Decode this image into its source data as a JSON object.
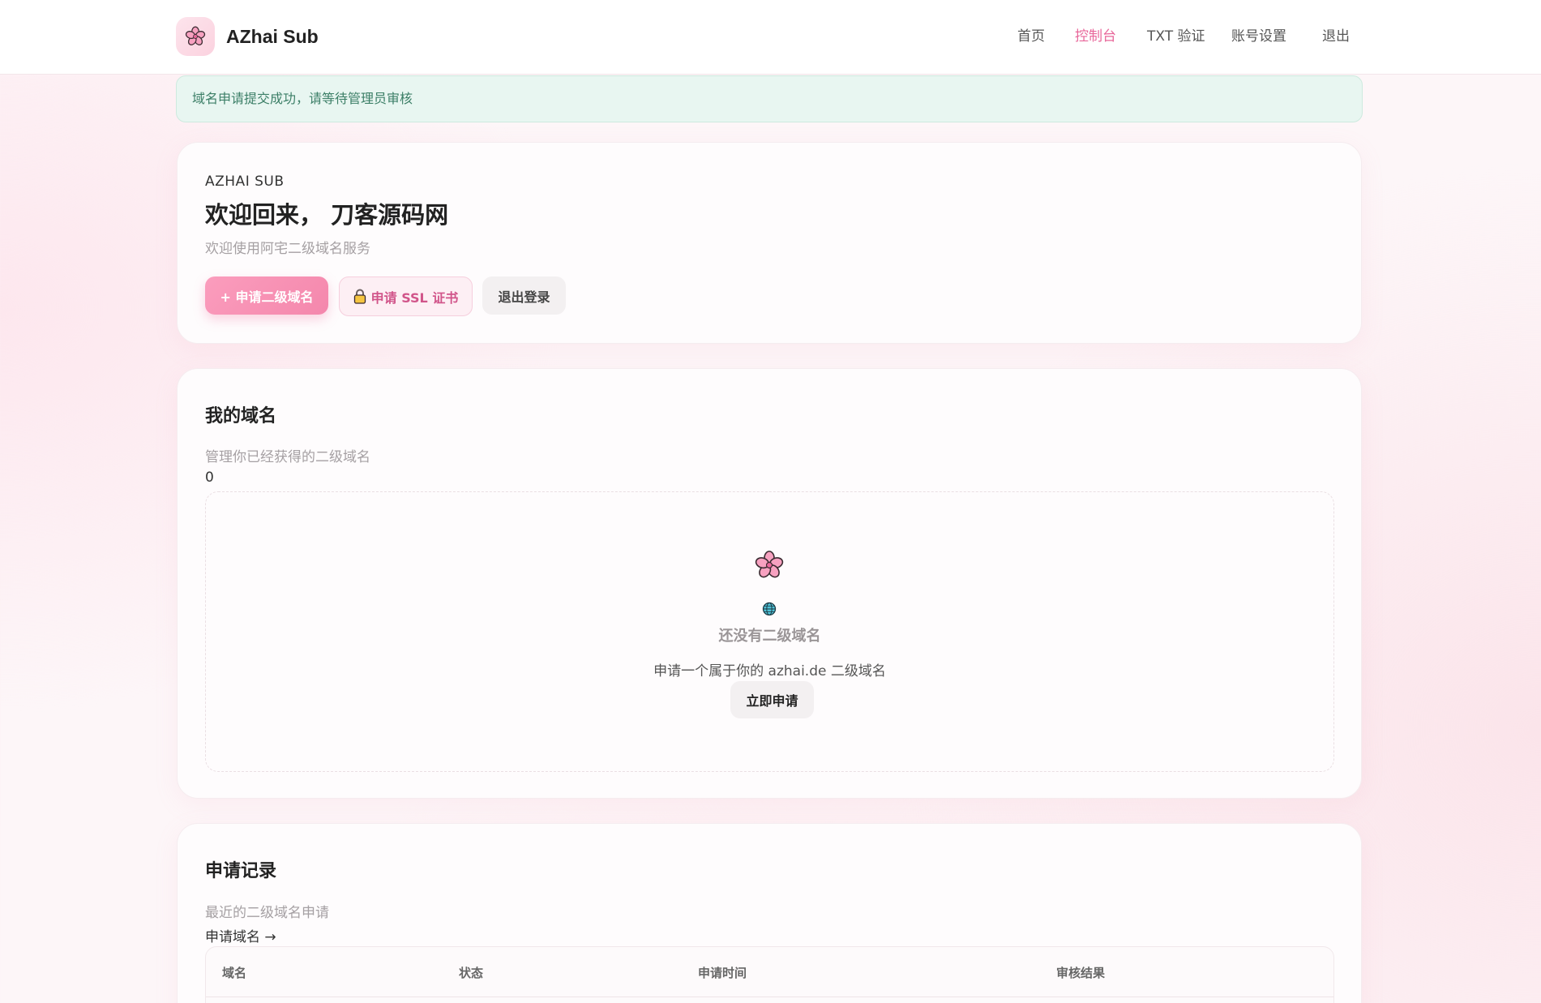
{
  "header": {
    "brand": "AZhai Sub",
    "nav": [
      {
        "label": "首页",
        "active": false
      },
      {
        "label": "控制台",
        "active": true
      },
      {
        "label": "TXT 验证",
        "active": false
      },
      {
        "label": "账号设置",
        "active": false
      },
      {
        "label": "退出",
        "active": false
      }
    ]
  },
  "alert": {
    "text": "域名申请提交成功，请等待管理员审核"
  },
  "welcome": {
    "eyebrow": "AZHAI SUB",
    "title": "欢迎回来， 刀客源码网",
    "subtitle": "欢迎使用阿宅二级域名服务",
    "buttons": {
      "apply": "+ 申请二级域名",
      "ssl": "申请 SSL 证书",
      "logout": "退出登录"
    }
  },
  "domains": {
    "title": "我的域名",
    "subtitle": "管理你已经获得的二级域名",
    "count": "0",
    "empty": {
      "title": "还没有二级域名",
      "desc": "申请一个属于你的 azhai.de 二级域名",
      "button": "立即申请"
    }
  },
  "records": {
    "title": "申请记录",
    "subtitle": "最近的二级域名申请",
    "link": "申请域名 →",
    "columns": [
      "域名",
      "状态",
      "申请时间",
      "审核结果"
    ]
  },
  "colors": {
    "accent": "#e8679a",
    "primary_button": "#f487ac",
    "alert_bg": "#e8f6f1",
    "alert_text": "#3c7f67"
  },
  "icons": {
    "brand": "cherry-blossom-icon",
    "ssl": "lock-icon",
    "empty": "cherry-blossom-icon",
    "globe": "globe-icon"
  }
}
